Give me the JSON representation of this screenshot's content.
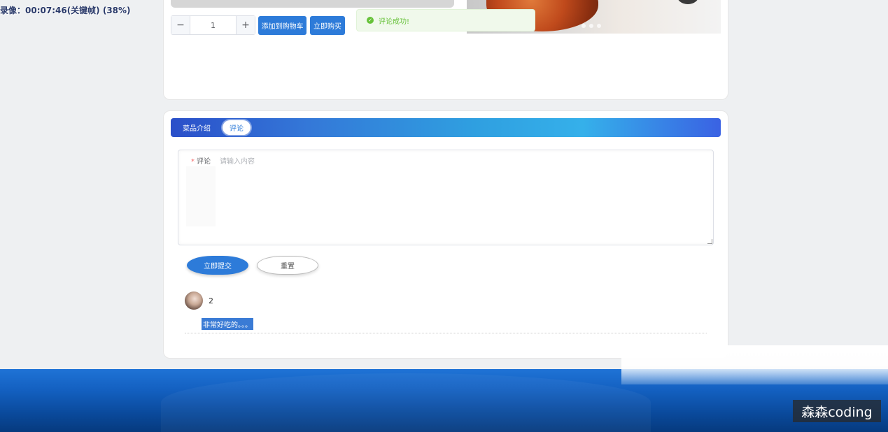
{
  "overlay": {
    "recording_label": "录像：00:07:46(关键帧) (38%)"
  },
  "product": {
    "quantity_value": "1",
    "minus_symbol": "−",
    "plus_symbol": "+",
    "add_to_cart_label": "添加到购物车",
    "buy_now_label": "立即购买"
  },
  "toast": {
    "message": "评论成功!",
    "icon": "success-check-icon"
  },
  "tabs": [
    {
      "label": "菜品介绍",
      "active": false
    },
    {
      "label": "评论",
      "active": true
    }
  ],
  "comment_form": {
    "label": "评论",
    "required_mark": "*",
    "placeholder": "请输入内容",
    "value": "",
    "submit_label": "立即提交",
    "reset_label": "重置"
  },
  "comments": [
    {
      "username": "2",
      "text": "非常好吃的。。。",
      "avatar": "user-avatar"
    }
  ],
  "watermark": "森森coding",
  "colors": {
    "primary": "#2d7bd9",
    "success": "#67c23a",
    "footer": "#135fbf"
  }
}
